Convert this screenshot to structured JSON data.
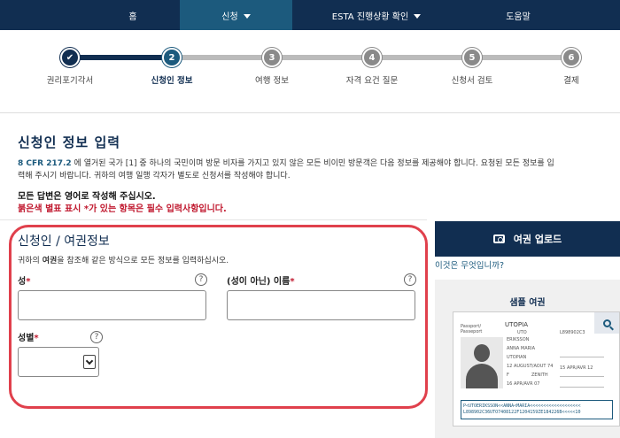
{
  "nav": {
    "items": [
      {
        "label": "홈",
        "dropdown": false,
        "active": false
      },
      {
        "label": "신청",
        "dropdown": true,
        "active": true
      },
      {
        "label": "ESTA 진행상황 확인",
        "dropdown": true,
        "active": false
      },
      {
        "label": "도움말",
        "dropdown": false,
        "active": false
      }
    ]
  },
  "stepper": {
    "steps": [
      {
        "number": "✔",
        "label": "권리포기각서",
        "state": "done"
      },
      {
        "number": "2",
        "label": "신청인 정보",
        "state": "current"
      },
      {
        "number": "3",
        "label": "여행 정보",
        "state": "todo"
      },
      {
        "number": "4",
        "label": "자격 요건 질문",
        "state": "todo"
      },
      {
        "number": "5",
        "label": "신청서 검토",
        "state": "todo"
      },
      {
        "number": "6",
        "label": "결제",
        "state": "todo"
      }
    ]
  },
  "page": {
    "title": "신청인 정보 입력",
    "intro_ref": "8 CFR 217.2",
    "intro_line1": " 에 열거된 국가 [1] 중 하나의 국민이며 방문 비자를 가지고 있지 않은 모든 비이민 방문객은 다음 정보를 제공해야 합니다. 요청된 모든 정보를 입",
    "intro_line2": "력해 주시기 바랍니다. 귀하의 여행 일행 각자가 별도로 신청서를 작성해야 합니다.",
    "note_english": "모든 답변은 영어로 작성해 주십시오.",
    "note_required": "붉은색 별표 표시 *가 있는 항목은 필수 입력사항입니다."
  },
  "form": {
    "title": "신청인 / 여권정보",
    "desc_prefix": "귀하의 ",
    "desc_bold": "여권",
    "desc_suffix": "을 참조해 같은 방식으로 모든 정보를 입력하십시오.",
    "surname_label": "성",
    "given_name_label": "(성이 아닌) 이름",
    "gender_label": "성별",
    "required_mark": "*",
    "help_glyph": "?",
    "surname_value": "",
    "given_name_value": "",
    "gender_value": ""
  },
  "sidebar": {
    "upload_label": "여권 업로드",
    "what_link": "이것은 무엇입니까?",
    "sample_title": "샘플 여권",
    "passport": {
      "country": "UTOPIA",
      "type_label": "Passport/",
      "type_label2": "Passeport",
      "code": "UTO",
      "number": "L898902C3",
      "surname": "ERIKSSON",
      "given": "ANNA MARIA",
      "nationality": "UTOPIAN",
      "dob": "12 AUGUST/AOUT 74",
      "sex": "F",
      "place": "ZENITH",
      "issue": "16 APR/AVR 07",
      "expiry": "15 APR/AVR 12",
      "mrz1": "P<UTOERIKSSON<<ANNA<MARIA<<<<<<<<<<<<<<<<<<<",
      "mrz2": "L898902C36UTO7408122F1204159ZE184226B<<<<<10"
    }
  }
}
